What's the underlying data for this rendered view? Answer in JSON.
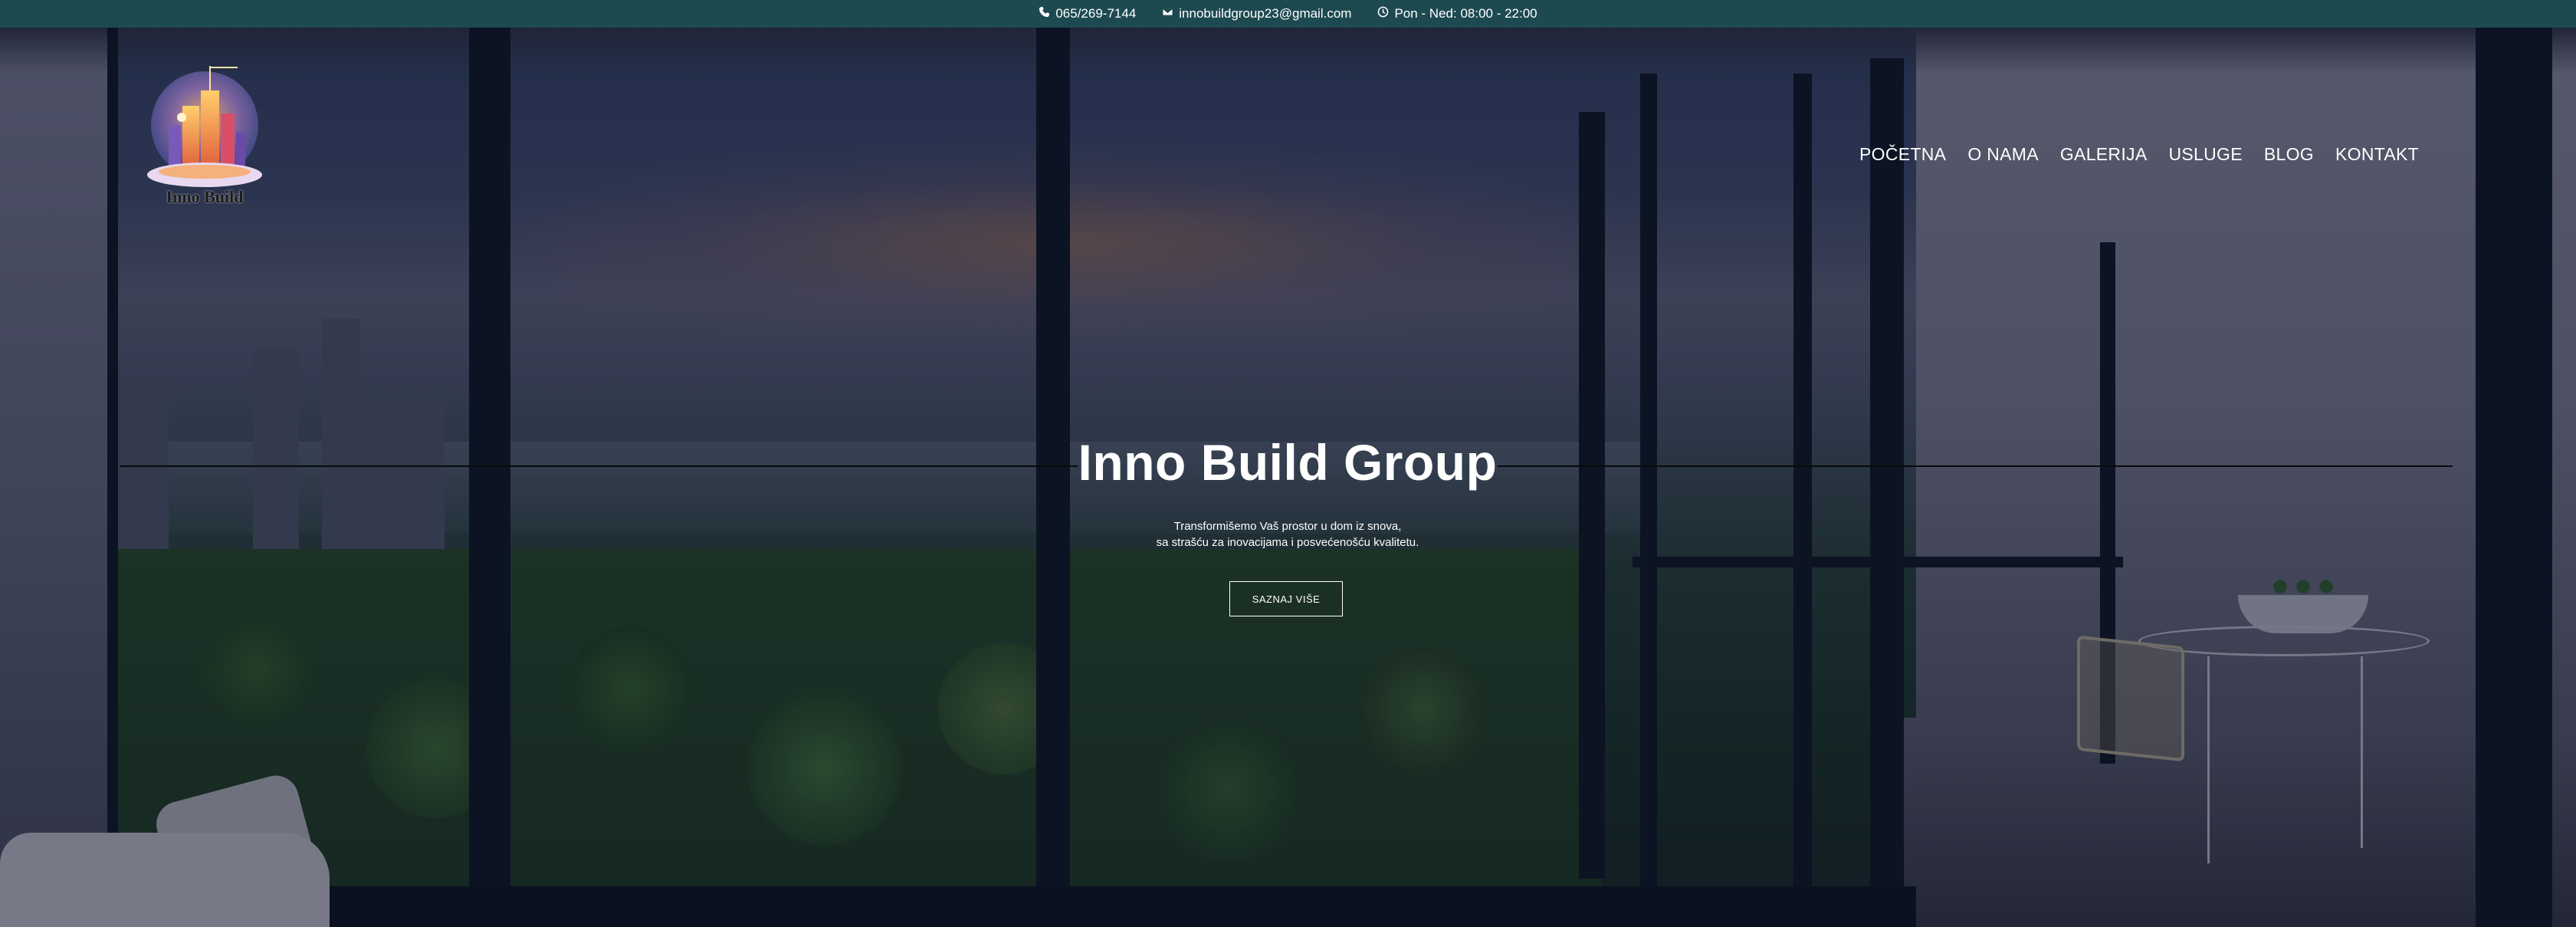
{
  "topbar": {
    "phone": "065/269-7144",
    "email": "innobuildgroup23@gmail.com",
    "hours": "Pon - Ned: 08:00 - 22:00"
  },
  "header": {
    "logo_text": "Inno Build",
    "nav": [
      "POČETNA",
      "O NAMA",
      "GALERIJA",
      "USLUGE",
      "BLOG",
      "KONTAKT"
    ]
  },
  "hero": {
    "title": "Inno Build Group",
    "subtitle_line1": "Transformišemo Vaš prostor u dom iz snova,",
    "subtitle_line2": "sa strašću za inovacijama i posvećenošću kvalitetu.",
    "cta_label": "SAZNAJ VIŠE"
  },
  "colors": {
    "topbar_bg": "#1d4a50",
    "text": "#ffffff"
  },
  "icons": [
    "phone-icon",
    "envelope-icon",
    "clock-icon"
  ]
}
